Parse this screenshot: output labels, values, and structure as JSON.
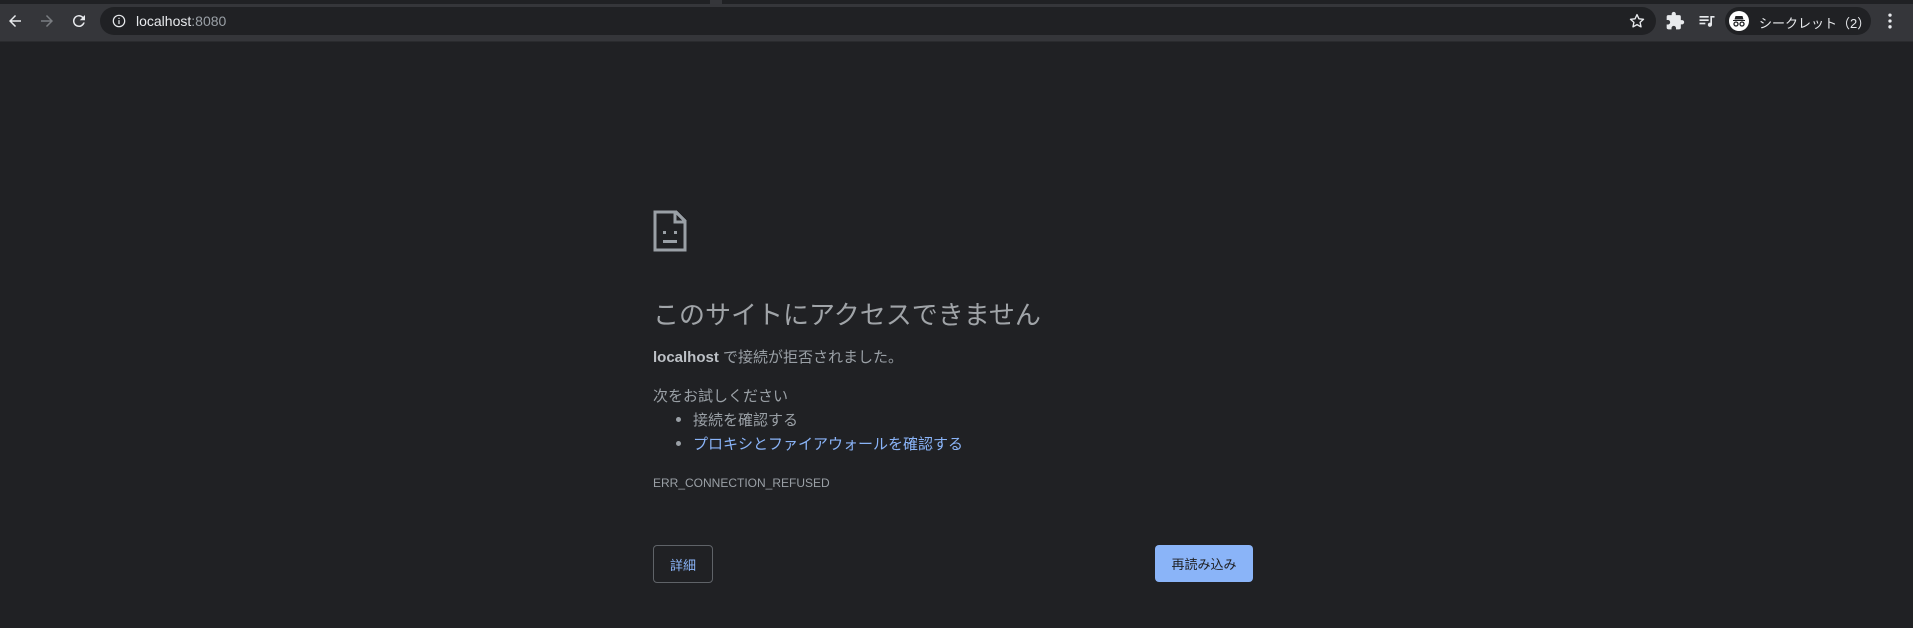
{
  "browser": {
    "url_host": "localhost",
    "url_port": ":8080",
    "profile_label": "シークレット（2）"
  },
  "icons": {
    "back": "arrow-left-icon",
    "forward": "arrow-right-icon",
    "reload": "reload-icon",
    "site_info": "info-icon",
    "bookmark": "star-icon",
    "extensions": "puzzle-icon",
    "media": "queue-music-icon",
    "incognito": "incognito-icon",
    "menu": "kebab-menu-icon",
    "error": "sad-document-icon"
  },
  "colors": {
    "page_bg": "#202124",
    "toolbar_bg": "#35363a",
    "link": "#8ab4f8",
    "button_primary": "#8ab4f8"
  },
  "error": {
    "heading": "このサイトにアクセスできません",
    "desc_host": "localhost",
    "desc_text": " で接続が拒否されました。",
    "try_label": "次をお試しください",
    "suggestions": [
      "接続を確認する",
      "プロキシとファイアウォールを確認する"
    ],
    "code": "ERR_CONNECTION_REFUSED",
    "details_button": "詳細",
    "reload_button": "再読み込み"
  }
}
